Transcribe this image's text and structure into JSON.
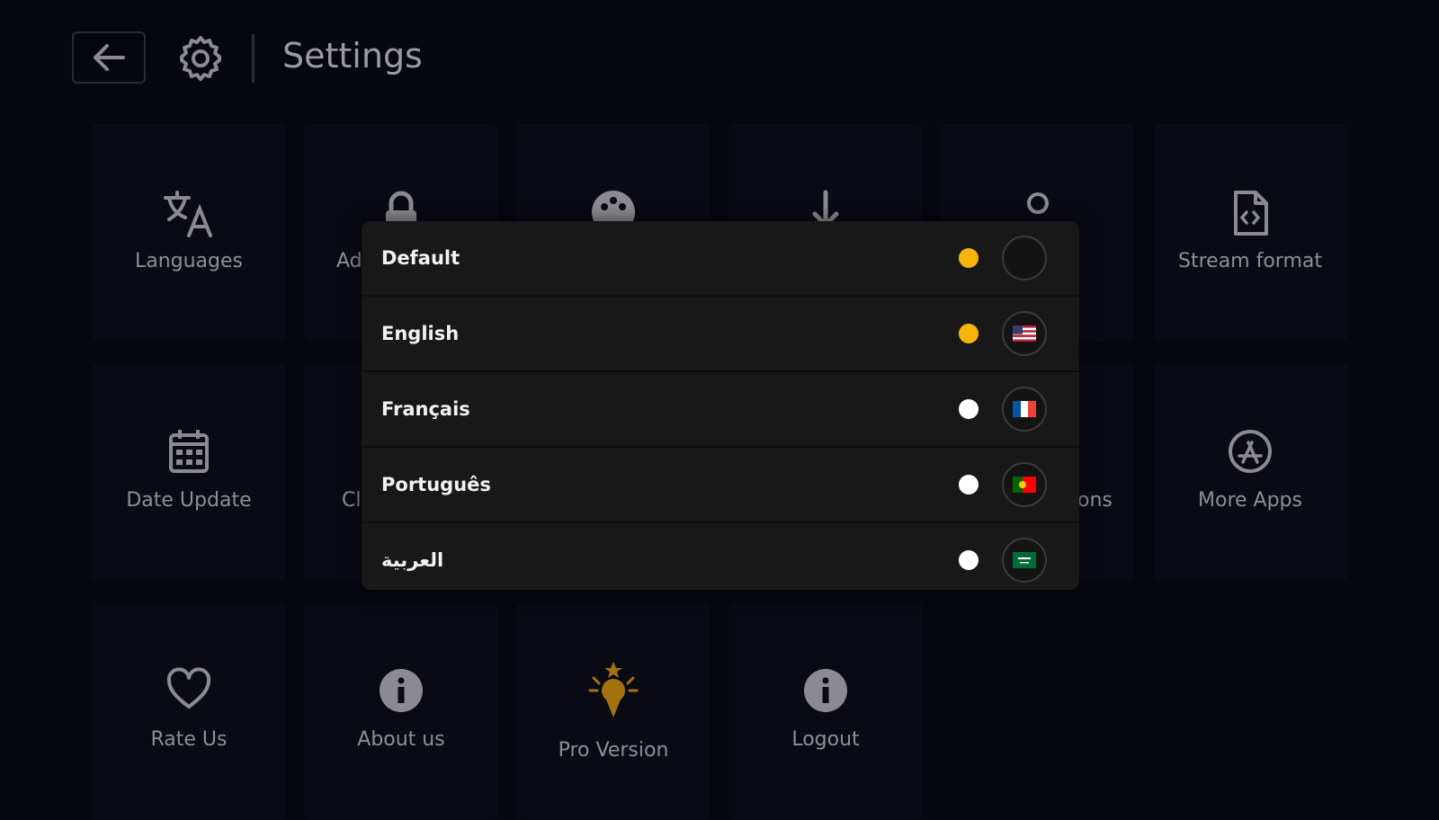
{
  "header": {
    "title": "Settings"
  },
  "tiles": [
    {
      "label": "Languages",
      "icon": "translate-icon"
    },
    {
      "label": "Ad",
      "icon": "lock-icon"
    },
    {
      "label": "",
      "icon": "palette-icon"
    },
    {
      "label": "",
      "icon": "download-icon"
    },
    {
      "label": "",
      "icon": "user-icon"
    },
    {
      "label": "Stream format",
      "icon": "file-code-icon"
    },
    {
      "label": "Date Update",
      "icon": "calendar-icon"
    },
    {
      "label": "Cl",
      "icon": ""
    },
    {
      "label": "ons",
      "icon": ""
    },
    {
      "label": "More Apps",
      "icon": "app-store-icon"
    },
    {
      "label": "Rate Us",
      "icon": "heart-icon"
    },
    {
      "label": "About us",
      "icon": "info-icon"
    },
    {
      "label": "Pro Version",
      "icon": "award-icon"
    },
    {
      "label": "Logout",
      "icon": "info-icon"
    }
  ],
  "language_dialog": {
    "options": [
      {
        "label": "Default",
        "selected": true,
        "flag": "none"
      },
      {
        "label": "English",
        "selected": true,
        "flag": "us-flag"
      },
      {
        "label": "Français",
        "selected": false,
        "flag": "france-flag"
      },
      {
        "label": "Português",
        "selected": false,
        "flag": "portugal-flag"
      },
      {
        "label": "العربية",
        "selected": false,
        "flag": "saudi-flag"
      }
    ]
  },
  "colors": {
    "accent": "#f5b40a",
    "unselected": "#ffffff",
    "background": "#06060f",
    "tile": "#0a0a14",
    "dialog": "#181818"
  }
}
